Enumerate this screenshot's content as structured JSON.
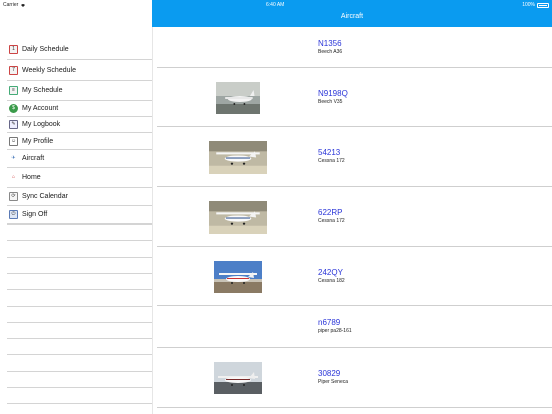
{
  "status": {
    "carrier": "Carrier",
    "time": "6:40 AM",
    "battery": "100%"
  },
  "nav": {
    "title": "Aircraft"
  },
  "menu": [
    {
      "label": "Daily Schedule",
      "icon": "calendar-icon"
    },
    {
      "label": "Weekly Schedule",
      "icon": "calendar-week-icon"
    },
    {
      "label": "My Schedule",
      "icon": "schedule-icon"
    },
    {
      "label": "My Account",
      "icon": "dollar-icon"
    },
    {
      "label": "My Logbook",
      "icon": "logbook-icon"
    },
    {
      "label": "My Profile",
      "icon": "profile-icon"
    },
    {
      "label": "Aircraft",
      "icon": "airplane-icon"
    },
    {
      "label": "Home",
      "icon": "home-icon"
    },
    {
      "label": "Sync Calendar",
      "icon": "sync-icon"
    },
    {
      "label": "Sign Off",
      "icon": "sign-off-icon"
    }
  ],
  "aircraft": [
    {
      "id": "N1356",
      "type": "Beech A36",
      "photo": "none"
    },
    {
      "id": "N9198Q",
      "type": "Beech V35",
      "photo": "aircraft-photo-beech"
    },
    {
      "id": "54213",
      "type": "Cessna 172",
      "photo": "aircraft-photo-hangar"
    },
    {
      "id": "622RP",
      "type": "Cessna 172",
      "photo": "aircraft-photo-hangar"
    },
    {
      "id": "242QY",
      "type": "Cessna 182",
      "photo": "aircraft-photo-sky"
    },
    {
      "id": "n6789",
      "type": "piper pa28-161",
      "photo": "none"
    },
    {
      "id": "30829",
      "type": "Piper Seneca",
      "photo": "aircraft-photo-ramp"
    }
  ],
  "colors": {
    "nav": "#0a9bf0",
    "link": "#2a35d8"
  }
}
